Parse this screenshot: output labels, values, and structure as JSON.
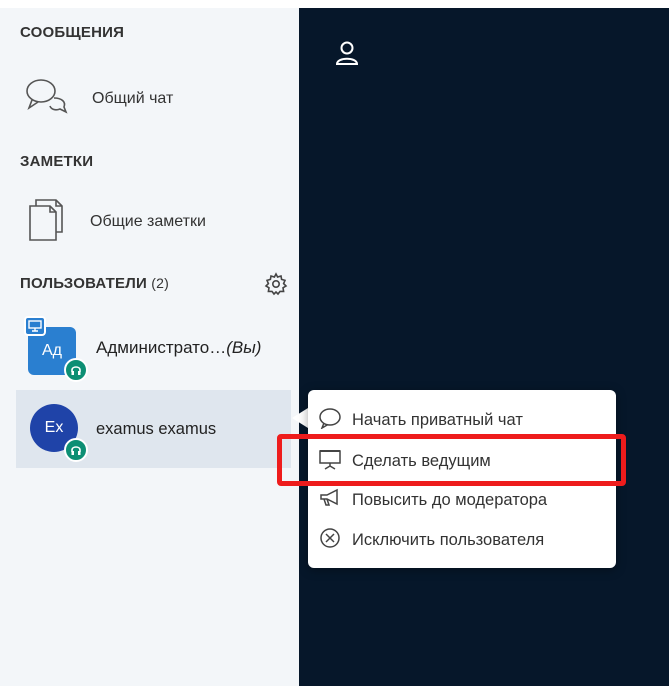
{
  "sections": {
    "messages": {
      "title": "СООБЩЕНИЯ",
      "public_chat": "Общий чат"
    },
    "notes": {
      "title": "ЗАМЕТКИ",
      "shared_notes": "Общие заметки"
    },
    "users": {
      "title": "ПОЛЬЗОВАТЕЛИ",
      "count": "(2)"
    }
  },
  "users": [
    {
      "initials": "Ад",
      "name": "Администрато…",
      "suffix": "(Вы)"
    },
    {
      "initials": "Ex",
      "name": "examus examus"
    }
  ],
  "context_menu": {
    "items": [
      {
        "label": "Начать приватный чат",
        "icon": "chat-bubble-icon"
      },
      {
        "label": "Сделать ведущим",
        "icon": "presentation-icon"
      },
      {
        "label": "Повысить до модератора",
        "icon": "megaphone-icon"
      },
      {
        "label": "Исключить пользователя",
        "icon": "close-circle-icon"
      }
    ]
  },
  "colors": {
    "sidebar_bg": "#f3f6f9",
    "dark_panel": "#06172a",
    "avatar_admin": "#2a7fd0",
    "avatar_user": "#1f43a8",
    "status_badge": "#0d8f74",
    "highlight": "#ee1c1c"
  }
}
